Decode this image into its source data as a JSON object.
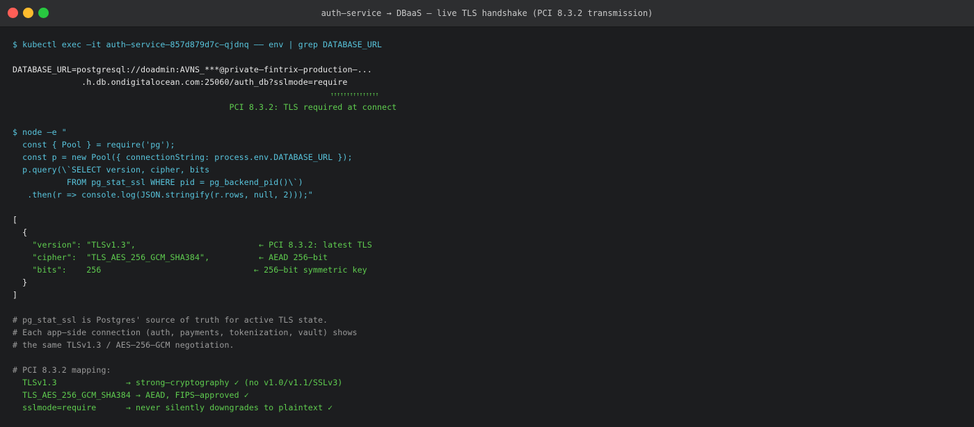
{
  "window": {
    "title": "auth–service → DBaaS — live TLS handshake (PCI 8.3.2 transmission)"
  },
  "terminal": {
    "cmd1": "$ kubectl exec –it auth–service–857d879d7c–qjdnq –– env | grep DATABASE_URL",
    "env1": "DATABASE_URL=postgresql://doadmin:AVNS_***@private–fintrix–production–...",
    "env2": "              .h.db.ondigitalocean.com:25060/auth_db?sslmode=require",
    "marks": "                                                                                                   ↑↑↑↑↑↑↑↑↑↑↑↑↑↑↑",
    "note1": "                                            PCI 8.3.2: TLS required at connect",
    "node1": "$ node –e \"",
    "node2": "  const { Pool } = require('pg');",
    "node3": "  const p = new Pool({ connectionString: process.env.DATABASE_URL });",
    "node4": "  p.query(\\`SELECT version, cipher, bits",
    "node5": "           FROM pg_stat_ssl WHERE pid = pg_backend_pid()\\`)",
    "node6": "   .then(r => console.log(JSON.stringify(r.rows, null, 2)));\"",
    "json_open": "[",
    "obj_open": "  {",
    "row_version": "    \"version\": \"TLSv1.3\",                         ← PCI 8.3.2: latest TLS",
    "row_cipher": "    \"cipher\":  \"TLS_AES_256_GCM_SHA384\",          ← AEAD 256–bit",
    "row_bits": "    \"bits\":    256                               ← 256–bit symmetric key",
    "obj_close": "  }",
    "json_close": "]",
    "c1": "# pg_stat_ssl is Postgres' source of truth for active TLS state.",
    "c2": "# Each app–side connection (auth, payments, tokenization, vault) shows",
    "c3": "# the same TLSv1.3 / AES–256–GCM negotiation.",
    "c4": "# PCI 8.3.2 mapping:",
    "m1": "  TLSv1.3              → strong–cryptography ✓ (no v1.0/v1.1/SSLv3)",
    "m2": "  TLS_AES_256_GCM_SHA384 → AEAD, FIPS–approved ✓",
    "m3": "  sslmode=require      → never silently downgrades to plaintext ✓"
  }
}
